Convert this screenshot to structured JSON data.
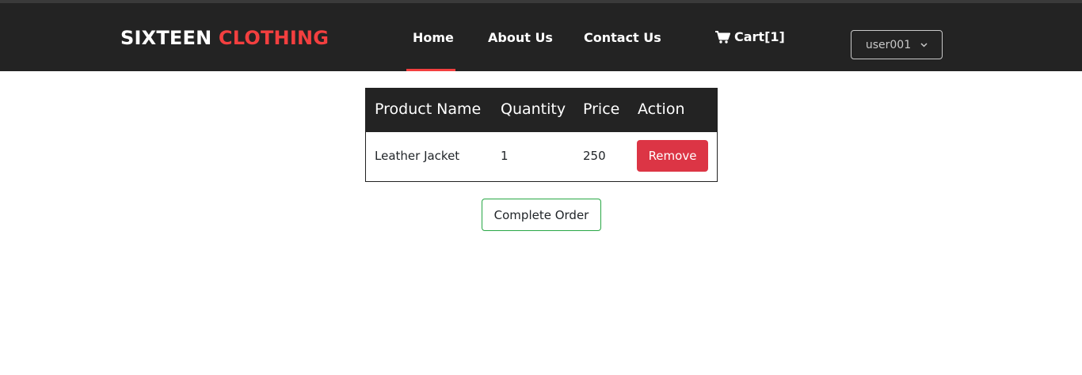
{
  "brand": {
    "part1": "SIXTEEN ",
    "part2": "CLOTHING",
    "accent_color": "#f33f3f"
  },
  "nav": {
    "items": [
      {
        "label": "Home",
        "active": true
      },
      {
        "label": "About Us",
        "active": false
      },
      {
        "label": "Contact Us",
        "active": false
      }
    ],
    "cart": {
      "icon": "cart-icon",
      "label": "Cart[1]"
    },
    "user": {
      "label": "user001",
      "icon": "chevron-down-icon"
    }
  },
  "table": {
    "headers": [
      "Product Name",
      "Quantity",
      "Price",
      "Action"
    ],
    "rows": [
      {
        "product": "Leather Jacket",
        "quantity": "1",
        "price": "250",
        "action_label": "Remove"
      }
    ]
  },
  "actions": {
    "complete_label": "Complete Order"
  },
  "colors": {
    "navbar": "#232323",
    "danger": "#dc3545",
    "success": "#28a745"
  }
}
